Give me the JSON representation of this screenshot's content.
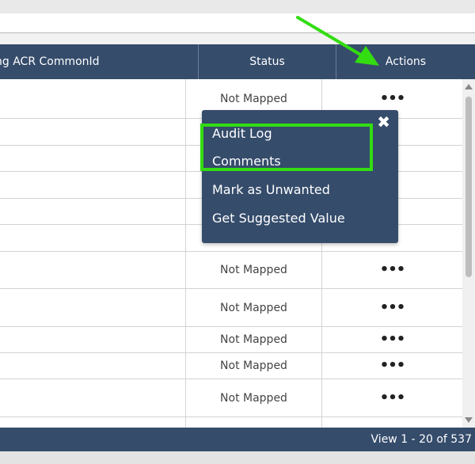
{
  "header": {
    "col_acr": "ng ACR CommonId",
    "col_status": "Status",
    "col_actions": "Actions"
  },
  "rows": [
    {
      "status": "Not Mapped",
      "actions": "•••"
    },
    {
      "status": "",
      "actions": ""
    },
    {
      "status": "",
      "actions": ""
    },
    {
      "status": "",
      "actions": ""
    },
    {
      "status": "",
      "actions": ""
    },
    {
      "status": "",
      "actions": ""
    },
    {
      "status": "Not Mapped",
      "actions": "•••"
    },
    {
      "status": "Not Mapped",
      "actions": "•••"
    },
    {
      "status": "Not Mapped",
      "actions": "•••"
    },
    {
      "status": "Not Mapped",
      "actions": "•••"
    },
    {
      "status": "Not Mapped",
      "actions": "•••"
    },
    {
      "status": "",
      "actions": ""
    }
  ],
  "actions_menu": {
    "close_icon": "✖",
    "items": [
      "Audit Log",
      "Comments",
      "Mark as Unwanted",
      "Get Suggested Value"
    ]
  },
  "footer": {
    "pager_info": "View 1 - 20 of 537"
  },
  "annotation_color": "#33dd11",
  "header_color": "#354c6b"
}
